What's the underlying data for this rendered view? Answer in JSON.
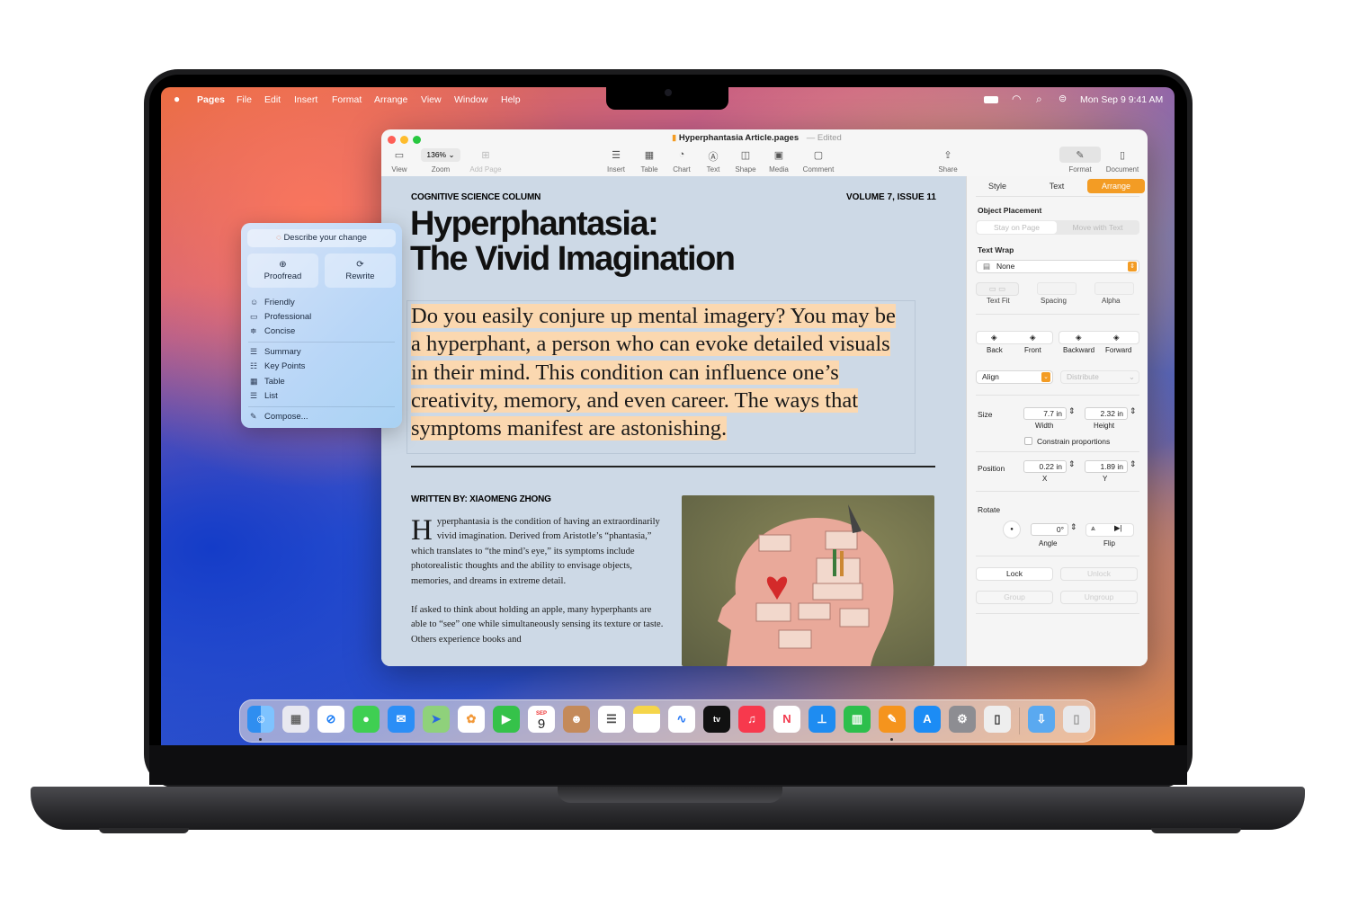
{
  "menubar": {
    "apple": "",
    "app": "Pages",
    "items": [
      "File",
      "Edit",
      "Insert",
      "Format",
      "Arrange",
      "View",
      "Window",
      "Help"
    ],
    "clock": "Mon Sep 9  9:41 AM"
  },
  "window": {
    "title": "Hyperphantasia Article.pages",
    "edited": "— Edited",
    "zoom": "136%",
    "toolbar": {
      "view": "View",
      "zoom": "Zoom",
      "add_page": "Add Page",
      "insert": "Insert",
      "table": "Table",
      "chart": "Chart",
      "text": "Text",
      "shape": "Shape",
      "media": "Media",
      "comment": "Comment",
      "share": "Share",
      "format": "Format",
      "document": "Document"
    }
  },
  "document": {
    "column": "COGNITIVE SCIENCE COLUMN",
    "volume": "VOLUME 7, ISSUE 11",
    "title_line1": "Hyperphantasia:",
    "title_line2": "The Vivid Imagination",
    "intro": "Do you easily conjure up mental imagery? You may be a hyperphant, a person who can evoke detailed visuals in their mind. This condition can influence one’s creativity, memory, and even career. The ways that symptoms manifest are astonishing.",
    "byline": "WRITTEN BY: XIAOMENG ZHONG",
    "dropcap": "H",
    "para1": "yperphantasia is the condition of having an extraordinarily vivid imagination. Derived from Aristotle’s “phantasia,” which translates to “the mind’s eye,” its symptoms include photorealistic thoughts and the ability to envisage objects, memories, and dreams in extreme detail.",
    "para2": "If asked to think about holding an apple, many hyperphants are able to “see” one while simultaneously sensing its texture or taste. Others experience books and"
  },
  "sidebar": {
    "tabs": [
      "Style",
      "Text",
      "Arrange"
    ],
    "object_placement": "Object Placement",
    "stay_on_page": "Stay on Page",
    "move_with_text": "Move with Text",
    "text_wrap": "Text Wrap",
    "wrap_value": "None",
    "text_fit": "Text Fit",
    "spacing": "Spacing",
    "alpha": "Alpha",
    "back": "Back",
    "front": "Front",
    "backward": "Backward",
    "forward": "Forward",
    "align": "Align",
    "distribute": "Distribute",
    "size": "Size",
    "width_val": "7.7 in",
    "width": "Width",
    "height_val": "2.32 in",
    "height": "Height",
    "constrain": "Constrain proportions",
    "position": "Position",
    "x_val": "0.22 in",
    "x": "X",
    "y_val": "1.89 in",
    "y": "Y",
    "rotate": "Rotate",
    "angle_val": "0°",
    "angle": "Angle",
    "flip": "Flip",
    "lock": "Lock",
    "unlock": "Unlock",
    "group": "Group",
    "ungroup": "Ungroup"
  },
  "writing_tools": {
    "describe": "Describe your change",
    "proofread": "Proofread",
    "rewrite": "Rewrite",
    "friendly": "Friendly",
    "professional": "Professional",
    "concise": "Concise",
    "summary": "Summary",
    "key_points": "Key Points",
    "table": "Table",
    "list": "List",
    "compose": "Compose..."
  },
  "dock": {
    "calendar_month": "SEP",
    "calendar_day": "9",
    "tv": "tv",
    "apps": [
      "Finder",
      "Launchpad",
      "Safari",
      "Messages",
      "Mail",
      "Maps",
      "Photos",
      "FaceTime",
      "Calendar",
      "Contacts",
      "Reminders",
      "Notes",
      "Freeform",
      "TV",
      "Music",
      "News",
      "Keynote",
      "Numbers",
      "Pages",
      "App Store",
      "System Settings",
      "iPhone Mirroring",
      "Downloads",
      "Trash"
    ]
  },
  "colors": {
    "accent": "#f39c24",
    "highlight": "#fbd8b0",
    "doc_bg": "#cdd9e6"
  }
}
